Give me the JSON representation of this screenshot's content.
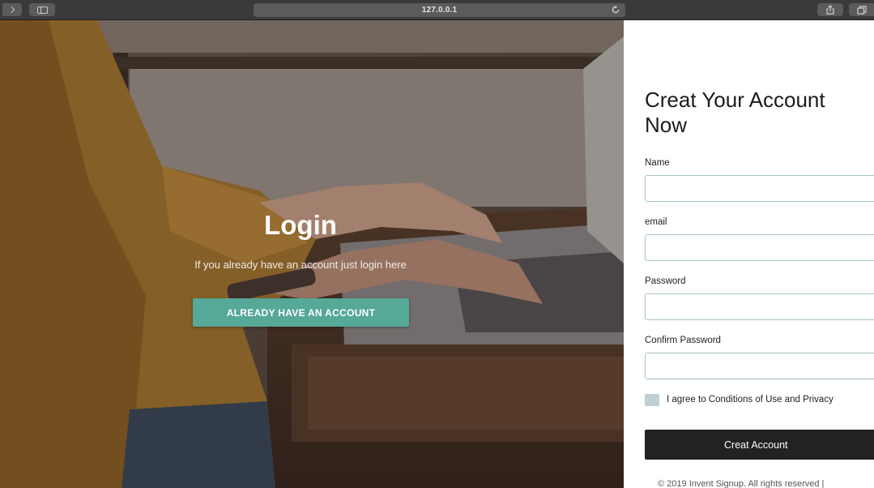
{
  "browser": {
    "address": "127.0.0.1"
  },
  "hero": {
    "title": "Login",
    "subtitle": "If you already have an account just login here",
    "button_label": "ALREADY HAVE AN ACCOUNT",
    "button_color": "#56a897"
  },
  "form": {
    "title": "Creat Your Account Now",
    "fields": [
      {
        "label": "Name",
        "value": "",
        "type": "text"
      },
      {
        "label": "email",
        "value": "",
        "type": "email"
      },
      {
        "label": "Password",
        "value": "",
        "type": "password"
      },
      {
        "label": "Confirm Password",
        "value": "",
        "type": "password"
      }
    ],
    "agree_label": "I agree to Conditions of Use and Privacy",
    "agree_checked": false,
    "submit_label": "Creat Account",
    "footer": "© 2019 Invent Signup. All rights reserved |"
  },
  "colors": {
    "accent": "#56a897",
    "submit": "#222222",
    "input_border": "#a9c3c6"
  },
  "icons": [
    "forward-icon",
    "sidebar-icon",
    "reload-icon",
    "share-icon",
    "tabs-icon"
  ]
}
